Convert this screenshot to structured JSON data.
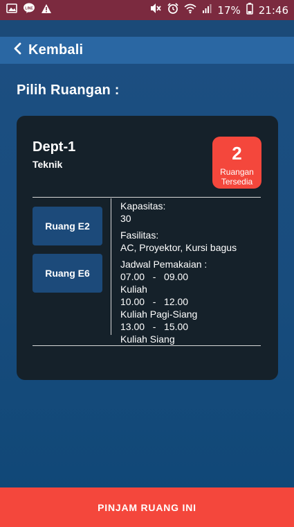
{
  "status_bar": {
    "battery": "17%",
    "time": "21:46",
    "icons": [
      "image-icon",
      "line-icon",
      "warning-icon",
      "mute-icon",
      "alarm-icon",
      "wifi-icon",
      "signal-icon",
      "battery-icon"
    ]
  },
  "header": {
    "back_label": "Kembali"
  },
  "page": {
    "title": "Pilih Ruangan :"
  },
  "card": {
    "dept": "Dept-1",
    "faculty": "Teknik",
    "badge": {
      "count": "2",
      "label_line1": "Ruangan",
      "label_line2": "Tersedia"
    },
    "rooms": [
      {
        "label": "Ruang E2"
      },
      {
        "label": "Ruang E6"
      }
    ],
    "details": {
      "capacity_label": "Kapasitas:",
      "capacity_value": "30",
      "facilities_label": "Fasilitas:",
      "facilities_value": "AC, Proyektor, Kursi bagus",
      "schedule_label": "Jadwal Pemakaian :",
      "schedule": [
        {
          "time": "07.00   -   09.00",
          "desc": "Kuliah"
        },
        {
          "time": "10.00   -   12.00",
          "desc": "Kuliah Pagi-Siang"
        },
        {
          "time": "13.00   -   15.00",
          "desc": "Kuliah Siang"
        }
      ]
    }
  },
  "footer": {
    "button_label": "PINJAM RUANG INI"
  },
  "colors": {
    "status_bar": "#7b2a3f",
    "app_bar": "#2a67a3",
    "background": "#1d4f82",
    "card": "#15212a",
    "accent_red": "#f4473c",
    "room_button": "#1c4a7a"
  }
}
